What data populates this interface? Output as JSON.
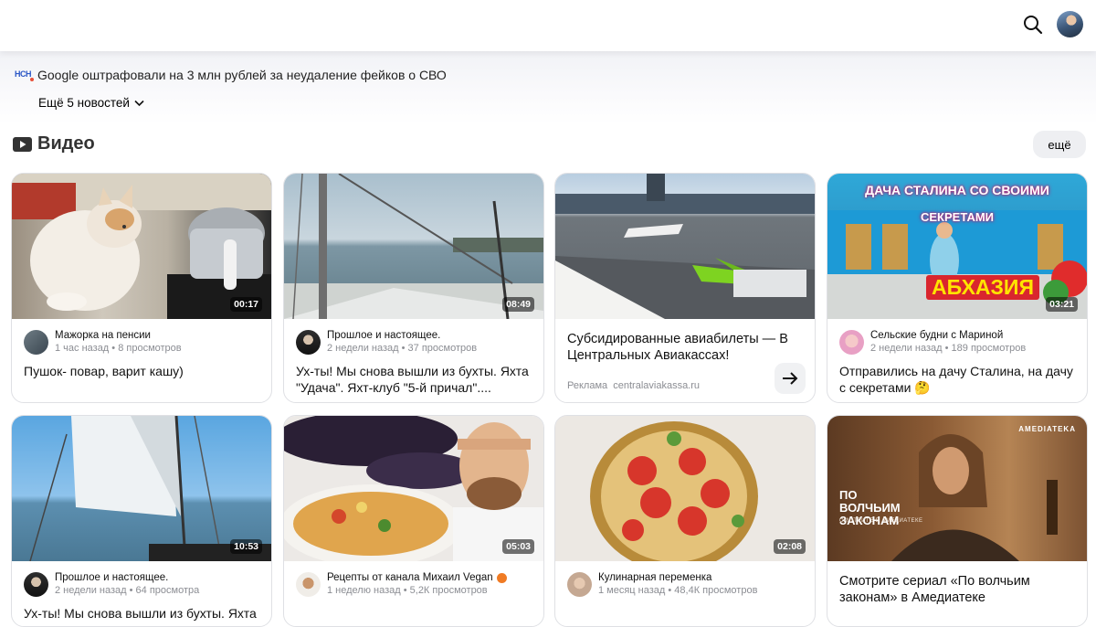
{
  "news": {
    "headline": "Google оштрафовали на 3 млн рублей за неудаление фейков о СВО",
    "source_logo": "НСН",
    "more_label": "Ещё 5 новостей"
  },
  "section": {
    "title": "Видео",
    "more_label": "ещё"
  },
  "cards": [
    {
      "channel": "Мажорка на пенсии",
      "time": "1 час назад",
      "views": "8 просмотров",
      "title": "Пушок- повар, варит кашу)",
      "duration": "00:17"
    },
    {
      "channel": "Прошлое и настоящее.",
      "time": "2 недели назад",
      "views": "37 просмотров",
      "title": "Ух-ты! Мы снова вышли из бухты. Яхта \"Удача\". Яхт-клуб \"5-й причал\"....",
      "duration": "08:49"
    },
    {
      "ad_title": "Субсидированные авиабилеты — В Центральных Авиакассах!",
      "ad_label": "Реклама",
      "ad_domain": "centralaviakassa.ru"
    },
    {
      "channel": "Сельские будни с Мариной",
      "time": "2 недели назад",
      "views": "189 просмотров",
      "title": "Отправились на дачу Сталина, на дачу с секретами 🤔",
      "duration": "03:21",
      "thumb_text_top": "ДАЧА СТАЛИНА СО СВОИМИ",
      "thumb_text_mid": "СЕКРЕТАМИ",
      "thumb_text_big": "АБХАЗИЯ"
    },
    {
      "channel": "Прошлое и настоящее.",
      "time": "2 недели назад",
      "views": "64 просмотра",
      "title": "Ух-ты! Мы снова вышли из бухты. Яхта",
      "duration": "10:53"
    },
    {
      "channel": "Рецепты от канала Михаил Vegan",
      "time": "1 неделю назад",
      "views": "5,2К просмотров",
      "title": "",
      "duration": "05:03"
    },
    {
      "channel": "Кулинарная переменка",
      "time": "1 месяц назад",
      "views": "48,4К просмотров",
      "title": "",
      "duration": "02:08"
    },
    {
      "ad_title": "Смотрите сериал «По волчьим законам» в Амедиатеке",
      "brand": "AMEDIATEKA",
      "show_title": "ПО ВОЛЧЬИМ ЗАКОНАМ",
      "show_sub": "СМОТРИТЕ В АМЕДИАТЕКЕ"
    }
  ]
}
